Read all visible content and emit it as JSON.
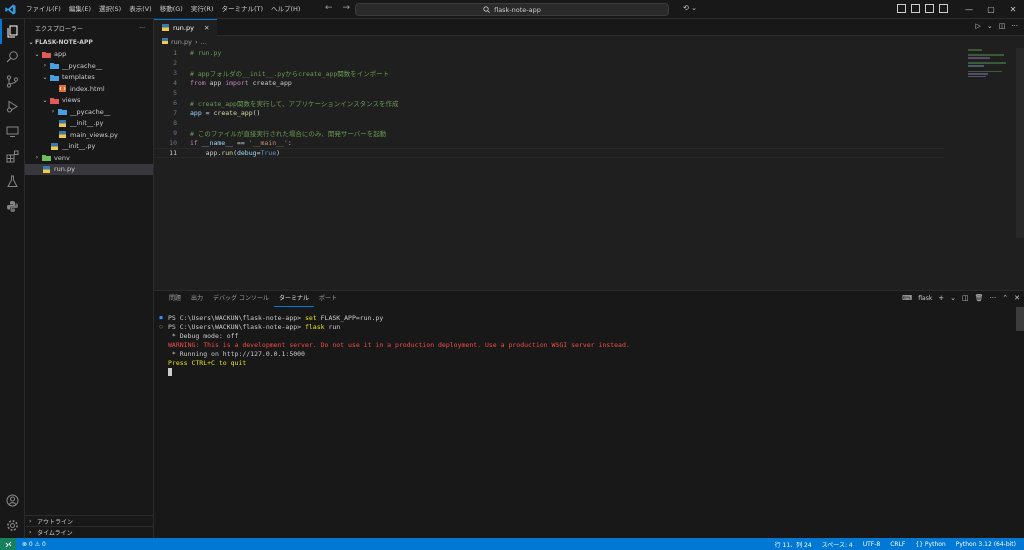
{
  "titlebar": {
    "menus": [
      "ファイル(F)",
      "編集(E)",
      "選択(S)",
      "表示(V)",
      "移動(G)",
      "実行(R)",
      "ターミナル(T)",
      "ヘルプ(H)"
    ],
    "search": "flask-note-app",
    "back": "←",
    "forward": "→",
    "copilot": "⟲ ⌄",
    "minimize": "—",
    "maximize": "▢",
    "close": "✕"
  },
  "sidebar": {
    "title": "エクスプローラー",
    "more": "···",
    "root": "FLASK-NOTE-APP",
    "tree": [
      {
        "label": "app",
        "indent": 0,
        "chev": "⌄",
        "type": "folder-red"
      },
      {
        "label": "__pycache__",
        "indent": 1,
        "chev": "›",
        "type": "folder-blue"
      },
      {
        "label": "templates",
        "indent": 1,
        "chev": "⌄",
        "type": "folder-blue"
      },
      {
        "label": "index.html",
        "indent": 2,
        "chev": "",
        "type": "html"
      },
      {
        "label": "views",
        "indent": 1,
        "chev": "⌄",
        "type": "folder-red"
      },
      {
        "label": "__pycache__",
        "indent": 2,
        "chev": "›",
        "type": "folder-blue"
      },
      {
        "label": "__init__.py",
        "indent": 2,
        "chev": "",
        "type": "py"
      },
      {
        "label": "main_views.py",
        "indent": 2,
        "chev": "",
        "type": "py"
      },
      {
        "label": "__init__.py",
        "indent": 1,
        "chev": "",
        "type": "py"
      },
      {
        "label": "venv",
        "indent": 0,
        "chev": "›",
        "type": "folder-green"
      },
      {
        "label": "run.py",
        "indent": 0,
        "chev": "",
        "type": "py",
        "selected": true
      }
    ],
    "outline": "アウトライン",
    "timeline": "タイムライン"
  },
  "editor": {
    "tab_label": "run.py",
    "breadcrumb_file": "run.py",
    "breadcrumb_more": "...",
    "lines": [
      {
        "n": "1",
        "tokens": [
          {
            "c": "c-cmt",
            "t": "# run.py"
          }
        ]
      },
      {
        "n": "2",
        "tokens": []
      },
      {
        "n": "3",
        "tokens": [
          {
            "c": "c-cmt",
            "t": "# appフォルダの__init__.pyからcreate_app関数をインポート"
          }
        ]
      },
      {
        "n": "4",
        "tokens": [
          {
            "c": "c-kw",
            "t": "from"
          },
          {
            "c": "c-def",
            "t": " app "
          },
          {
            "c": "c-kw",
            "t": "import"
          },
          {
            "c": "c-def",
            "t": " create_app"
          }
        ]
      },
      {
        "n": "5",
        "tokens": []
      },
      {
        "n": "6",
        "tokens": [
          {
            "c": "c-cmt",
            "t": "# create_app関数を実行して、アプリケーションインスタンスを作成"
          }
        ]
      },
      {
        "n": "7",
        "tokens": [
          {
            "c": "c-var",
            "t": "app"
          },
          {
            "c": "c-pun",
            "t": " = "
          },
          {
            "c": "c-fn",
            "t": "create_app"
          },
          {
            "c": "c-pun",
            "t": "()"
          }
        ]
      },
      {
        "n": "8",
        "tokens": []
      },
      {
        "n": "9",
        "tokens": [
          {
            "c": "c-cmt",
            "t": "# このファイルが直接実行された場合にのみ、開発サーバーを起動"
          }
        ]
      },
      {
        "n": "10",
        "tokens": [
          {
            "c": "c-kw",
            "t": "if"
          },
          {
            "c": "c-var",
            "t": " __name__"
          },
          {
            "c": "c-pun",
            "t": " == "
          },
          {
            "c": "c-str",
            "t": "'__main__'"
          },
          {
            "c": "c-pun",
            "t": ":"
          }
        ]
      },
      {
        "n": "11",
        "tokens": [
          {
            "c": "c-def",
            "t": "    app."
          },
          {
            "c": "c-fn",
            "t": "run"
          },
          {
            "c": "c-pun",
            "t": "("
          },
          {
            "c": "c-var",
            "t": "debug"
          },
          {
            "c": "c-pun",
            "t": "="
          },
          {
            "c": "c-con",
            "t": "True"
          },
          {
            "c": "c-pun",
            "t": ")"
          }
        ],
        "current": true
      }
    ]
  },
  "panel": {
    "tabs": [
      "問題",
      "出力",
      "デバッグ コンソール",
      "ターミナル",
      "ポート"
    ],
    "active_tab": 3,
    "terminal_name": "flask",
    "terminal_lines": [
      {
        "mark": "■",
        "mark_color": "#3794ff",
        "parts": [
          {
            "c": "",
            "t": "PS C:\\Users\\WACKUN\\flask-note-app> "
          },
          {
            "c": "t-cmd",
            "t": "set"
          },
          {
            "c": "",
            "t": " FLASK_APP=run.py"
          }
        ]
      },
      {
        "mark": "○",
        "mark_color": "#9d9d9d",
        "parts": [
          {
            "c": "",
            "t": "PS C:\\Users\\WACKUN\\flask-note-app> "
          },
          {
            "c": "t-cmd",
            "t": "flask"
          },
          {
            "c": "",
            "t": " run"
          }
        ]
      },
      {
        "mark": "",
        "parts": [
          {
            "c": "",
            "t": " * Debug mode: off"
          }
        ]
      },
      {
        "mark": "",
        "parts": [
          {
            "c": "t-warn",
            "t": "WARNING: This is a development server. Do not use it in a production deployment. Use a production WSGI server instead."
          }
        ]
      },
      {
        "mark": "",
        "parts": [
          {
            "c": "",
            "t": " * Running on http://127.0.0.1:5000"
          }
        ]
      },
      {
        "mark": "",
        "parts": [
          {
            "c": "t-yel",
            "t": "Press CTRL+C to quit"
          }
        ]
      }
    ]
  },
  "statusbar": {
    "errors": "⊗ 0 ⚠ 0",
    "items": [
      "行 11、列 24",
      "スペース: 4",
      "UTF-8",
      "CRLF",
      "{} Python",
      "Python 3.12 (64-bit)"
    ]
  },
  "colors": {
    "accent": "#0078d4",
    "status_bar": "#0078d4",
    "remote": "#16825d",
    "background": "#1f1f1f"
  }
}
